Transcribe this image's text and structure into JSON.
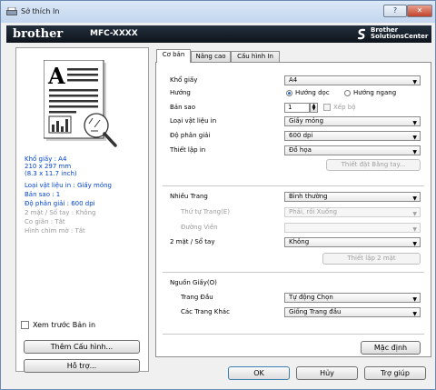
{
  "window": {
    "title": "Sở thích In",
    "help_button": "?",
    "close_button": "✕"
  },
  "banner": {
    "brand": "brother",
    "model": "MFC-XXXX",
    "solutions_line1": "Brother",
    "solutions_line2": "SolutionsCenter"
  },
  "summary": {
    "paper_size": "Khổ giấy : A4",
    "dimensions_mm": "210 x 297 mm",
    "dimensions_inch": "(8.3 x 11.7 inch)",
    "media_type": "Loại vật liệu in : Giấy mỏng",
    "copies": "Bản sao : 1",
    "resolution": "Độ phân giải : 600 dpi",
    "duplex": "2 mặt / Sổ tay : Không",
    "scaling": "Co giãn : Tắt",
    "watermark": "Hình chìm mờ : Tắt"
  },
  "preview_checkbox_label": "Xem trước Bản in",
  "left_buttons": {
    "add_profile": "Thêm Cấu hình...",
    "support": "Hỗ trợ..."
  },
  "tabs": [
    "Cơ bản",
    "Nâng cao",
    "Cấu hình In"
  ],
  "basic": {
    "paper_size_label": "Khổ giấy",
    "paper_size_value": "A4",
    "orientation_label": "Hướng",
    "portrait": "Hướng dọc",
    "landscape": "Hướng ngang",
    "copies_label": "Bản sao",
    "copies_value": "1",
    "collate": "Xếp bộ",
    "media_label": "Loại vật liệu in",
    "media_value": "Giấy mỏng",
    "resolution_label": "Độ phân giải",
    "resolution_value": "600 dpi",
    "print_settings_label": "Thiết lập in",
    "print_settings_value": "Đồ họa",
    "manual_settings_button": "Thiết đặt Bằng tay...",
    "multipage_label": "Nhiều Trang",
    "multipage_value": "Bình thường",
    "page_order_label": "Thứ tự Trang(E)",
    "page_order_value": "Phải, rồi Xuống",
    "border_label": "Đường Viền",
    "border_value": "",
    "duplex_label": "2 mặt / Sổ tay",
    "duplex_value": "Không",
    "duplex_settings_button": "Thiết lập 2 mặt",
    "paper_source_label": "Nguồn Giấy(O)",
    "first_page_label": "Trang Đầu",
    "first_page_value": "Tự động Chọn",
    "other_pages_label": "Các Trang Khác",
    "other_pages_value": "Giống Trang đầu",
    "default_button": "Mặc định"
  },
  "dialog_buttons": {
    "ok": "OK",
    "cancel": "Hủy",
    "help": "Trợ giúp"
  }
}
